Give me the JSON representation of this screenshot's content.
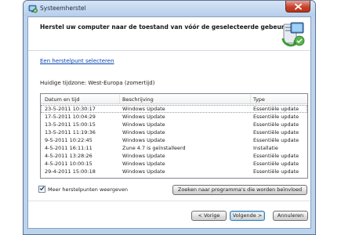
{
  "window": {
    "title": "Systeemherstel"
  },
  "header": {
    "title": "Herstel uw computer naar de toestand van vóór de geselecteerde gebeurtenis"
  },
  "select_link": "Een herstelpunt selecteren",
  "timezone": "Huidige tijdzone: West-Europa (zomertijd)",
  "table": {
    "columns": [
      "Datum en tijd",
      "Beschrijving",
      "Type"
    ],
    "rows": [
      {
        "date": "23-5-2011 10:30:17",
        "description": "Windows Update",
        "type": "Essentiële update"
      },
      {
        "date": "17-5-2011 10:04:29",
        "description": "Windows Update",
        "type": "Essentiële update"
      },
      {
        "date": "13-5-2011 15:00:15",
        "description": "Windows Update",
        "type": "Essentiële update"
      },
      {
        "date": "13-5-2011 11:19:36",
        "description": "Windows Update",
        "type": "Essentiële update"
      },
      {
        "date": "9-5-2011 10:22:45",
        "description": "Windows Update",
        "type": "Essentiële update"
      },
      {
        "date": "4-5-2011 16:11:11",
        "description": "Zune 4.7 is geïnstalleerd",
        "type": "Installatie"
      },
      {
        "date": "4-5-2011 13:28:26",
        "description": "Windows Update",
        "type": "Essentiële update"
      },
      {
        "date": "4-5-2011 10:00:15",
        "description": "Windows Update",
        "type": "Essentiële update"
      },
      {
        "date": "29-4-2011 15:00:18",
        "description": "Windows Update",
        "type": "Essentiële update"
      }
    ]
  },
  "show_more_checkbox": {
    "label": "Meer herstelpunten weergeven",
    "checked": true
  },
  "buttons": {
    "search": "Zoeken naar programma's die worden beïnvloed",
    "previous": "< Vorige",
    "next": "Volgende >",
    "cancel": "Annuleren"
  },
  "icons": {
    "title": "system-restore-icon",
    "header": "system-restore-computer-icon",
    "close": "close-icon",
    "check": "checkmark-icon"
  },
  "colors": {
    "frame": "#bcd3ee",
    "link": "#0645b4",
    "close": "#c7442d",
    "default_button_border": "#3c7fb1"
  }
}
